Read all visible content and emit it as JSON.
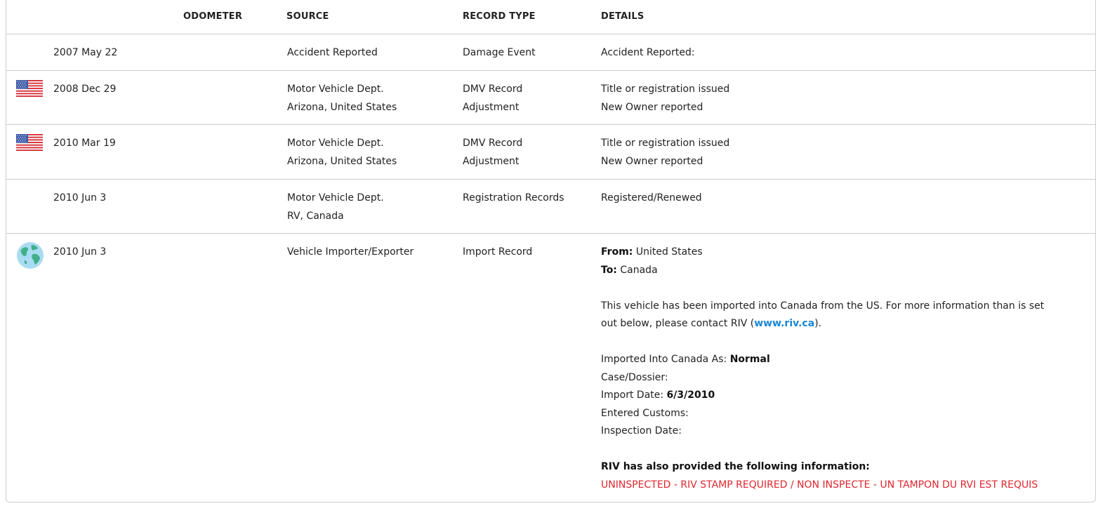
{
  "headers": {
    "odometer": "ODOMETER",
    "source": "SOURCE",
    "record_type": "RECORD TYPE",
    "details": "DETAILS"
  },
  "colors": {
    "border": "#c8ccd2",
    "link": "#1a86d6",
    "warning": "#e0262e"
  },
  "rows": [
    {
      "icon": "none",
      "date": "2007 May 22",
      "odometer": "",
      "source": [
        "Accident Reported"
      ],
      "record_type": [
        "Damage Event"
      ],
      "details": [
        "Accident Reported:"
      ]
    },
    {
      "icon": "us-flag-icon",
      "date": "2008 Dec 29",
      "odometer": "",
      "source": [
        "Motor Vehicle Dept.",
        "Arizona, United States"
      ],
      "record_type": [
        "DMV Record",
        "Adjustment"
      ],
      "details": [
        "Title or registration issued",
        "New Owner reported"
      ]
    },
    {
      "icon": "us-flag-icon",
      "date": "2010 Mar 19",
      "odometer": "",
      "source": [
        "Motor Vehicle Dept.",
        "Arizona, United States"
      ],
      "record_type": [
        "DMV Record",
        "Adjustment"
      ],
      "details": [
        "Title or registration issued",
        "New Owner reported"
      ]
    },
    {
      "icon": "none",
      "date": "2010 Jun 3",
      "odometer": "",
      "source": [
        "Motor Vehicle Dept.",
        "RV, Canada"
      ],
      "record_type": [
        "Registration Records"
      ],
      "details": [
        "Registered/Renewed"
      ]
    },
    {
      "icon": "globe-icon",
      "date": "2010 Jun 3",
      "odometer": "",
      "source": [
        "Vehicle Importer/Exporter"
      ],
      "record_type": [
        "Import Record"
      ],
      "import_details": {
        "from_label": "From:",
        "from_value": "United States",
        "to_label": "To:",
        "to_value": "Canada",
        "paragraph_line1": "This vehicle has been imported into Canada from the US. For more information than is set",
        "paragraph_line2_before": "out below, please contact RIV (",
        "riv_link": "www.riv.ca",
        "paragraph_line2_after": ").",
        "imported_as_label": "Imported Into Canada As:",
        "imported_as_value": "Normal",
        "case_label": "Case/Dossier:",
        "import_date_label": "Import Date:",
        "import_date_value": "6/3/2010",
        "customs_label": "Entered Customs:",
        "inspection_label": "Inspection Date:",
        "riv_info_heading": "RIV has also provided the following information:",
        "riv_warning": "UNINSPECTED - RIV STAMP REQUIRED / NON INSPECTE - UN TAMPON DU RVI EST REQUIS"
      }
    }
  ]
}
